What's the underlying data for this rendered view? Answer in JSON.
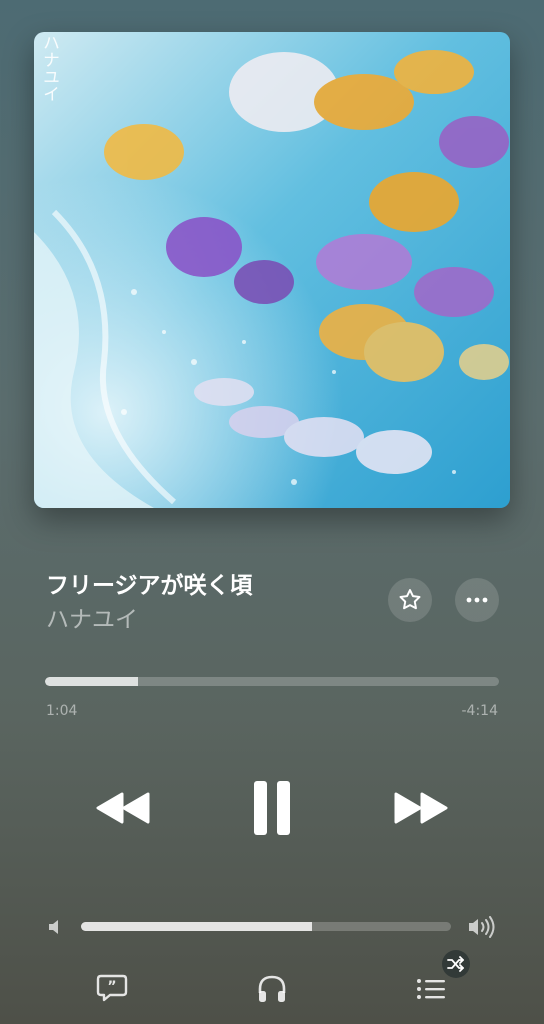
{
  "album": {
    "cover_text": "ハナユイ"
  },
  "track": {
    "title": "フリージアが咲く頃",
    "artist": "ハナユイ"
  },
  "playback": {
    "elapsed": "1:04",
    "remaining": "-4:14",
    "progress_fraction": 0.205,
    "state": "playing"
  },
  "volume": {
    "level_fraction": 0.624
  },
  "icons": {
    "favorite": "star-icon",
    "more": "more-icon",
    "rewind": "rewind-icon",
    "pause": "pause-icon",
    "forward": "fast-forward-icon",
    "volume_low": "volume-low-icon",
    "volume_high": "volume-high-icon",
    "lyrics": "lyrics-icon",
    "airplay": "headphones-icon",
    "queue": "queue-icon",
    "shuffle": "shuffle-icon"
  }
}
